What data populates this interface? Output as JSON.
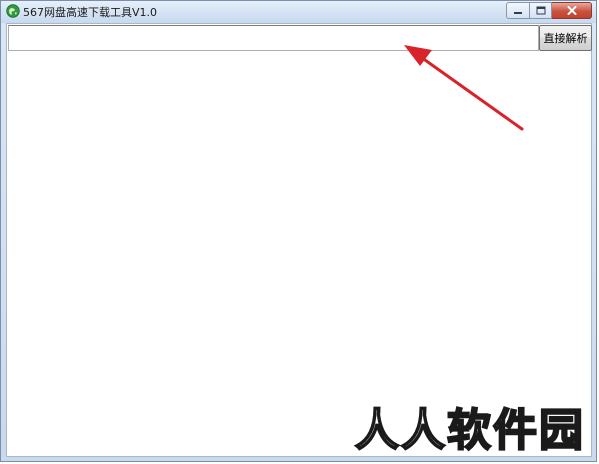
{
  "window": {
    "title": "567网盘高速下载工具V1.0",
    "app_icon": "green-globe-icon"
  },
  "caption_buttons": {
    "minimize_icon": "minimize-icon",
    "maximize_icon": "maximize-icon",
    "close_icon": "close-icon"
  },
  "toolbar": {
    "url_value": "",
    "url_placeholder": "",
    "parse_label": "直接解析"
  },
  "overlay": {
    "arrow_icon": "red-arrow-icon",
    "arrow_color": "#d8232a",
    "watermark": "人人软件园"
  },
  "colors": {
    "close_button": "#c8533f",
    "titlebar": "#d3e1f3"
  }
}
